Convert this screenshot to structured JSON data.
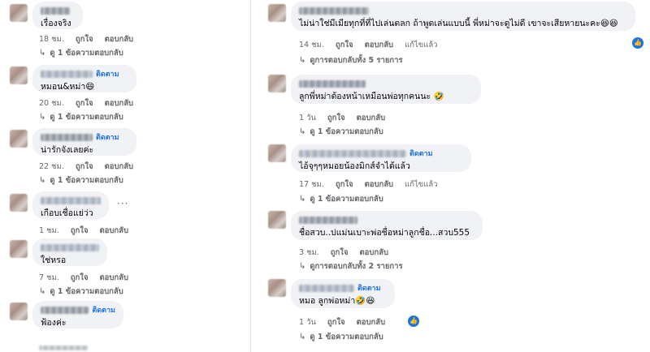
{
  "left": [
    {
      "text": "เรื่องจริง",
      "follow": "",
      "time": "18 ชม.",
      "like": "ถูกใจ",
      "reply": "ตอบกลับ",
      "replies": "ดู 1 ข้อความตอบกลับ"
    },
    {
      "text": "หมอน&หม่า😄",
      "follow": "ติดตาม",
      "time": "20 ชม.",
      "like": "ถูกใจ",
      "reply": "ตอบกลับ",
      "replies": "ดู 1 ข้อความตอบกลับ"
    },
    {
      "text": "น่ารักจังเลยค่ะ",
      "follow": "ติดตาม",
      "time": "22 ชม.",
      "like": "ถูกใจ",
      "reply": "ตอบกลับ",
      "replies": "ดู 1 ข้อความตอบกลับ"
    },
    {
      "text": "เกือบเชื่อแย่ว่ว",
      "follow": "",
      "time": "1 ชม.",
      "like": "ถูกใจ",
      "reply": "ตอบกลับ",
      "replies": "ดู 1 ข้อความตอบกลับ"
    },
    {
      "text": "ใช่หรอ",
      "follow": "",
      "time": "7 ชม.",
      "like": "ถูกใจ",
      "reply": "ตอบกลับ",
      "replies": "ดู 1 ข้อความตอบกลับ"
    },
    {
      "text": "ฟ้องค่ะ",
      "follow": "ติดตาม",
      "time": "",
      "like": "",
      "reply": "",
      "replies": ""
    }
  ],
  "right": [
    {
      "text": "ไม่น่าใช่มีเมียทุกที่ที่ไปเล่นตลก ถ้าพูดเล่นแบบนี้ พี่หม่าจะดูไม่ดี เขาจะเสียหายนะคะ😆😆",
      "follow": "",
      "time": "14 ชม.",
      "like": "ถูกใจ",
      "reply": "ตอบกลับ",
      "edited": "แก้ไขแล้ว",
      "replies": "ดูการตอบกลับทั้ง 5 รายการ"
    },
    {
      "text": "ลูกพี่หม่าต้องหน้าเหมือนพ่อทุกคนนะ 🤣",
      "follow": "",
      "time": "1 วัน",
      "like": "ถูกใจ",
      "reply": "ตอบกลับ",
      "edited": "",
      "replies": "ดู 1 ข้อความตอบกลับ"
    },
    {
      "text": "ไอ้จุๆๆหมอยน้องมิกส์จำได้แล้ว",
      "follow": "ติดตาม",
      "time": "17 ชม.",
      "like": "ถูกใจ",
      "reply": "ตอบกลับ",
      "edited": "แก้ไขแล้ว",
      "replies": "ดู 1 ข้อความตอบกลับ"
    },
    {
      "text": "ชื่อสวบ..บ่แม่นเบาะพ่อชื่อหม่าลูกชื่อ...สวบ555",
      "follow": "",
      "time": "3 ชม.",
      "like": "ถูกใจ",
      "reply": "ตอบกลับ",
      "edited": "",
      "replies": "ดูการตอบกลับทั้ง 2 รายการ"
    },
    {
      "text": "หมอ ลูกพ่อหม่า🤣😆",
      "follow": "ติดตาม",
      "time": "1 วัน",
      "like": "ถูกใจ",
      "reply": "ตอบกลับ",
      "edited": "",
      "replies": "ดู 1 ข้อความตอบกลับ"
    }
  ],
  "icons": {
    "reply_arrow": "↳",
    "more": "···",
    "like_badge": "👍"
  },
  "colors": {
    "bubble": "#f0f2f5",
    "follow": "#1b74e4",
    "meta": "#65676b"
  }
}
